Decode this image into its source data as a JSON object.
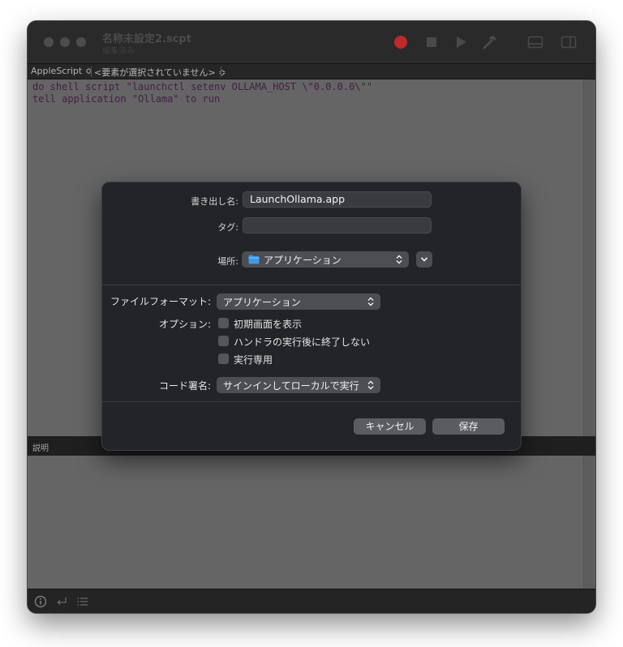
{
  "window": {
    "title": "名称未設定2.scpt",
    "subtitle": "編集済み"
  },
  "navbar": {
    "language": "AppleScript ≎",
    "element": "<要素が選択されていません> ≎"
  },
  "editor": {
    "lines": [
      "do shell script \"launchctl setenv OLLAMA_HOST \\\"0.0.0.0\\\"\"",
      "tell application \"Ollama\" to run"
    ]
  },
  "description": {
    "label": "説明"
  },
  "dialog": {
    "export_name_label": "書き出し名:",
    "export_name_value": "LaunchOllama.app",
    "tags_label": "タグ:",
    "tags_value": "",
    "location_label": "場所:",
    "location_value": "アプリケーション",
    "file_format_label": "ファイルフォーマット:",
    "file_format_value": "アプリケーション",
    "options_label": "オプション:",
    "options": [
      {
        "label": "初期画面を表示",
        "checked": false
      },
      {
        "label": "ハンドラの実行後に終了しない",
        "checked": false
      },
      {
        "label": "実行専用",
        "checked": false
      }
    ],
    "code_sign_label": "コード署名:",
    "code_sign_value": "サインインしてローカルで実行",
    "cancel_label": "キャンセル",
    "save_label": "保存"
  },
  "colors": {
    "record_button": "#c0282b",
    "folder_icon": "#3d9ae8",
    "code_text": "#431f46"
  }
}
